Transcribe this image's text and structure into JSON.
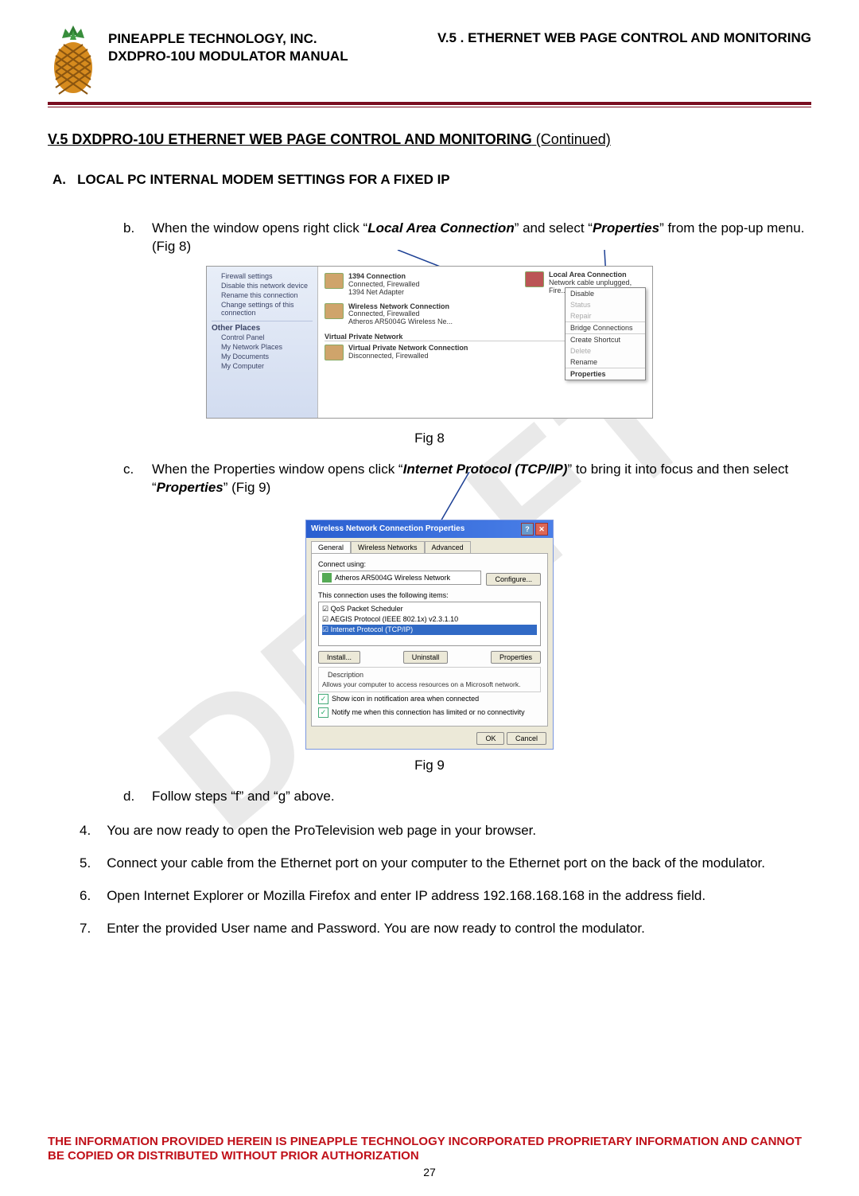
{
  "watermark": "DRAFT",
  "header": {
    "company": "PINEAPPLE TECHNOLOGY, INC.",
    "manual": "DXDPRO-10U MODULATOR MANUAL",
    "section_ref": "V.5 . ETHERNET WEB PAGE CONTROL AND MONITORING"
  },
  "title": {
    "main": "V.5  DXDPRO-10U ETHERNET WEB PAGE CONTROL AND MONITORING",
    "cont": " (Continued)"
  },
  "section_a": {
    "label": "A.",
    "text": "LOCAL PC INTERNAL MODEM SETTINGS FOR A FIXED IP"
  },
  "steps": {
    "b": {
      "letter": "b.",
      "pre": "When the window opens right click “",
      "em1": "Local Area Connection",
      "mid": "” and select “",
      "em2": "Properties",
      "post": "” from the pop-up menu. (Fig 8)"
    },
    "c": {
      "letter": "c.",
      "pre": "When the Properties window opens click “",
      "em1": "Internet Protocol (TCP/IP)",
      "mid": "” to bring it into focus and then select “",
      "em2": "Properties",
      "post": "” (Fig 9)"
    },
    "d": {
      "letter": "d.",
      "text": "Follow steps “f” and “g” above."
    },
    "s4": {
      "num": "4.",
      "text": "You are now ready to open the ProTelevision web page in your browser."
    },
    "s5": {
      "num": "5.",
      "text": "Connect your cable from the Ethernet port on your computer to the Ethernet port on the back of the modulator."
    },
    "s6": {
      "num": "6.",
      "text": "Open Internet Explorer or Mozilla Firefox and enter IP address 192.168.168.168 in the address field."
    },
    "s7": {
      "num": "7.",
      "text": "Enter the provided User name and Password.  You are now ready to control the modulator."
    }
  },
  "fig8": {
    "caption": "Fig 8",
    "sidebar": {
      "net_tasks": [
        "Firewall settings",
        "Disable this network device",
        "Rename this connection",
        "Change settings of this connection"
      ],
      "other_hdr": "Other Places",
      "other": [
        "Control Panel",
        "My Network Places",
        "My Documents",
        "My Computer"
      ]
    },
    "items": {
      "i1": {
        "name": "1394 Connection",
        "sub": "Connected, Firewalled",
        "dev": "1394 Net Adapter"
      },
      "i2": {
        "name": "Wireless Network Connection",
        "sub": "Connected, Firewalled",
        "dev": "Atheros AR5004G Wireless Ne..."
      },
      "vpn_hdr": "Virtual Private Network",
      "i3": {
        "name": "Virtual Private Network Connection",
        "sub": "Disconnected, Firewalled"
      },
      "lac": {
        "name": "Local Area Connection",
        "sub": "Network cable unplugged, Fire..."
      }
    },
    "menu": [
      "Disable",
      "Status",
      "Repair",
      "Bridge Connections",
      "Create Shortcut",
      "Delete",
      "Rename",
      "Properties"
    ]
  },
  "fig9": {
    "caption": "Fig 9",
    "title": "Wireless Network Connection Properties",
    "tabs": [
      "General",
      "Wireless Networks",
      "Advanced"
    ],
    "connect_using": "Connect using:",
    "adapter": "Atheros AR5004G Wireless Network",
    "configure_btn": "Configure...",
    "items_label": "This connection uses the following items:",
    "list": [
      "QoS Packet Scheduler",
      "AEGIS Protocol (IEEE 802.1x) v2.3.1.10",
      "Internet Protocol (TCP/IP)"
    ],
    "install_btn": "Install...",
    "uninstall_btn": "Uninstall",
    "props_btn": "Properties",
    "desc_hdr": "Description",
    "desc": "Allows your computer to access resources on a Microsoft network.",
    "chk1": "Show icon in notification area when connected",
    "chk2": "Notify me when this connection has limited or no connectivity",
    "ok_btn": "OK",
    "cancel_btn": "Cancel"
  },
  "footer": {
    "line": "THE INFORMATION PROVIDED HEREIN IS PINEAPPLE TECHNOLOGY INCORPORATED PROPRIETARY INFORMATION AND CANNOT BE COPIED OR DISTRIBUTED WITHOUT PRIOR AUTHORIZATION",
    "pagenum": "27"
  }
}
